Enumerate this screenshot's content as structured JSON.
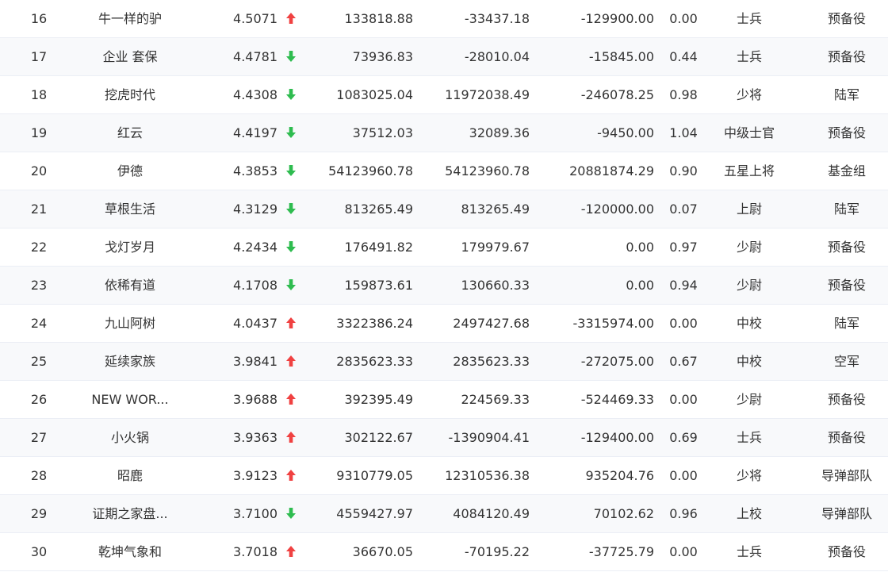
{
  "colors": {
    "up": "#f04141",
    "down": "#2ebc4f",
    "row_alt": "#f8f9fb",
    "divider": "#ebeef5"
  },
  "icons": {
    "up": "arrow-up-icon",
    "down": "arrow-down-icon"
  },
  "rows": [
    {
      "rank": "16",
      "name": "牛一样的驴",
      "score": "4.5071",
      "trend": "up",
      "v1": "133818.88",
      "v2": "-33437.18",
      "v3": "-129900.00",
      "ratio": "0.00",
      "title": "士兵",
      "team": "预备役"
    },
    {
      "rank": "17",
      "name": "企业 套保",
      "score": "4.4781",
      "trend": "down",
      "v1": "73936.83",
      "v2": "-28010.04",
      "v3": "-15845.00",
      "ratio": "0.44",
      "title": "士兵",
      "team": "预备役"
    },
    {
      "rank": "18",
      "name": "挖虎时代",
      "score": "4.4308",
      "trend": "down",
      "v1": "1083025.04",
      "v2": "11972038.49",
      "v3": "-246078.25",
      "ratio": "0.98",
      "title": "少将",
      "team": "陆军"
    },
    {
      "rank": "19",
      "name": "红云",
      "score": "4.4197",
      "trend": "down",
      "v1": "37512.03",
      "v2": "32089.36",
      "v3": "-9450.00",
      "ratio": "1.04",
      "title": "中级士官",
      "team": "预备役"
    },
    {
      "rank": "20",
      "name": "伊德",
      "score": "4.3853",
      "trend": "down",
      "v1": "54123960.78",
      "v2": "54123960.78",
      "v3": "20881874.29",
      "ratio": "0.90",
      "title": "五星上将",
      "team": "基金组"
    },
    {
      "rank": "21",
      "name": "草根生活",
      "score": "4.3129",
      "trend": "down",
      "v1": "813265.49",
      "v2": "813265.49",
      "v3": "-120000.00",
      "ratio": "0.07",
      "title": "上尉",
      "team": "陆军"
    },
    {
      "rank": "22",
      "name": "戈灯岁月",
      "score": "4.2434",
      "trend": "down",
      "v1": "176491.82",
      "v2": "179979.67",
      "v3": "0.00",
      "ratio": "0.97",
      "title": "少尉",
      "team": "预备役"
    },
    {
      "rank": "23",
      "name": "依稀有道",
      "score": "4.1708",
      "trend": "down",
      "v1": "159873.61",
      "v2": "130660.33",
      "v3": "0.00",
      "ratio": "0.94",
      "title": "少尉",
      "team": "预备役"
    },
    {
      "rank": "24",
      "name": "九山阿树",
      "score": "4.0437",
      "trend": "up",
      "v1": "3322386.24",
      "v2": "2497427.68",
      "v3": "-3315974.00",
      "ratio": "0.00",
      "title": "中校",
      "team": "陆军"
    },
    {
      "rank": "25",
      "name": "延续家族",
      "score": "3.9841",
      "trend": "up",
      "v1": "2835623.33",
      "v2": "2835623.33",
      "v3": "-272075.00",
      "ratio": "0.67",
      "title": "中校",
      "team": "空军"
    },
    {
      "rank": "26",
      "name": "NEW WOR...",
      "score": "3.9688",
      "trend": "up",
      "v1": "392395.49",
      "v2": "224569.33",
      "v3": "-524469.33",
      "ratio": "0.00",
      "title": "少尉",
      "team": "预备役"
    },
    {
      "rank": "27",
      "name": "小火锅",
      "score": "3.9363",
      "trend": "up",
      "v1": "302122.67",
      "v2": "-1390904.41",
      "v3": "-129400.00",
      "ratio": "0.69",
      "title": "士兵",
      "team": "预备役"
    },
    {
      "rank": "28",
      "name": "昭鹿",
      "score": "3.9123",
      "trend": "up",
      "v1": "9310779.05",
      "v2": "12310536.38",
      "v3": "935204.76",
      "ratio": "0.00",
      "title": "少将",
      "team": "导弹部队"
    },
    {
      "rank": "29",
      "name": "证期之家盘...",
      "score": "3.7100",
      "trend": "down",
      "v1": "4559427.97",
      "v2": "4084120.49",
      "v3": "70102.62",
      "ratio": "0.96",
      "title": "上校",
      "team": "导弹部队"
    },
    {
      "rank": "30",
      "name": "乾坤气象和",
      "score": "3.7018",
      "trend": "up",
      "v1": "36670.05",
      "v2": "-70195.22",
      "v3": "-37725.79",
      "ratio": "0.00",
      "title": "士兵",
      "team": "预备役"
    }
  ]
}
